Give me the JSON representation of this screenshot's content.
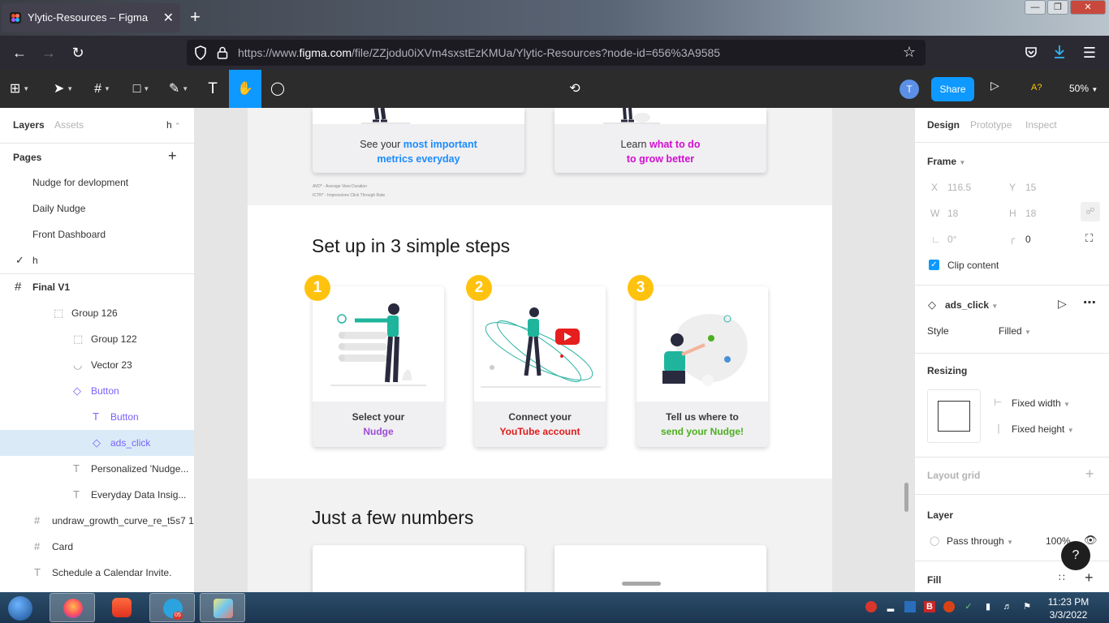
{
  "browser": {
    "tab_title": "Ylytic-Resources – Figma",
    "close_tab": "✕",
    "new_tab": "+",
    "url_prefix": "https://www.",
    "url_host": "figma.com",
    "url_path": "/file/ZZjodu0iXVm4sxstEzKMUa/Ylytic-Resources?node-id=656%3A9585",
    "window_buttons": [
      "—",
      "❐",
      "✕"
    ]
  },
  "toolbar": {
    "avatar_initial": "T",
    "share_label": "Share",
    "a11y_label": "A?",
    "zoom_label": "50%"
  },
  "left_panel": {
    "tabs": {
      "layers": "Layers",
      "assets": "Assets",
      "page_shortcut": "h"
    },
    "pages_title": "Pages",
    "pages": [
      {
        "label": "Nudge for devlopment",
        "checked": false
      },
      {
        "label": "Daily Nudge",
        "checked": false
      },
      {
        "label": "Front Dashboard",
        "checked": false
      },
      {
        "label": "h",
        "checked": true
      }
    ],
    "layers": [
      {
        "label": "Final V1",
        "icon": "frame-icon",
        "glyph": "#",
        "indent": 16,
        "bold": true
      },
      {
        "label": "Group 126",
        "icon": "group-icon",
        "glyph": "⬚",
        "indent": 64
      },
      {
        "label": "Group 122",
        "icon": "group-icon",
        "glyph": "⬚",
        "indent": 88
      },
      {
        "label": "Vector 23",
        "icon": "vector-icon",
        "glyph": "◡",
        "indent": 88
      },
      {
        "label": "Button",
        "icon": "component-instance-icon",
        "glyph": "◇",
        "indent": 88,
        "purple": true
      },
      {
        "label": "Button",
        "icon": "text-icon",
        "glyph": "T",
        "indent": 112,
        "purple": true
      },
      {
        "label": "ads_click",
        "icon": "component-instance-icon",
        "glyph": "◇",
        "indent": 112,
        "purple": true,
        "selected": true
      },
      {
        "label": "Personalized 'Nudge...",
        "icon": "text-icon",
        "glyph": "T",
        "indent": 88
      },
      {
        "label": "Everyday Data Insig...",
        "icon": "text-icon",
        "glyph": "T",
        "indent": 88
      },
      {
        "label": "undraw_growth_curve_re_t5s7 1",
        "icon": "frame-icon",
        "glyph": "#",
        "indent": 40
      },
      {
        "label": "Card",
        "icon": "frame-icon",
        "glyph": "#",
        "indent": 40
      },
      {
        "label": "Schedule a Calendar Invite.",
        "icon": "text-icon",
        "glyph": "T",
        "indent": 40
      }
    ]
  },
  "canvas": {
    "top_cards": [
      {
        "line1_plain": "See your ",
        "line1_accent": "most important",
        "line2_accent": "metrics everyday",
        "accent": "#1a8cff"
      },
      {
        "line1_plain": "Learn ",
        "line1_accent": "what to do",
        "line2_accent": "to grow better",
        "accent": "#d10ed1"
      }
    ],
    "footnotes": [
      "AVD* - Average View Duration",
      "ICTR* - Impressions Click Through Rate"
    ],
    "steps_heading": "Set up in 3 simple steps",
    "steps": [
      {
        "number": "1",
        "line1": "Select your",
        "line2": "Nudge",
        "accent": "#9b4dd6"
      },
      {
        "number": "2",
        "line1": "Connect your",
        "line2": "YouTube account",
        "accent": "#e01b1b"
      },
      {
        "number": "3",
        "line1": "Tell us where to",
        "line2": "send your Nudge!",
        "accent": "#4caf1f"
      }
    ],
    "numbers_heading": "Just a few numbers"
  },
  "right_panel": {
    "tabs": {
      "design": "Design",
      "prototype": "Prototype",
      "inspect": "Inspect"
    },
    "frame_label": "Frame",
    "x_label": "X",
    "x_value": "116.5",
    "y_label": "Y",
    "y_value": "15",
    "w_label": "W",
    "w_value": "18",
    "h_label": "H",
    "h_value": "18",
    "rotation_value": "0°",
    "radius_value": "0",
    "clip_content": "Clip content",
    "component_name": "ads_click",
    "style_label": "Style",
    "style_value": "Filled",
    "resizing_title": "Resizing",
    "fixed_width": "Fixed width",
    "fixed_height": "Fixed height",
    "layout_grid": "Layout grid",
    "layer_title": "Layer",
    "blend_mode": "Pass through",
    "opacity": "100%",
    "fill_title": "Fill",
    "help": "?"
  },
  "taskbar": {
    "clock_time": "11:23 PM",
    "clock_date": "3/3/2022",
    "telegram_badge": "05"
  }
}
